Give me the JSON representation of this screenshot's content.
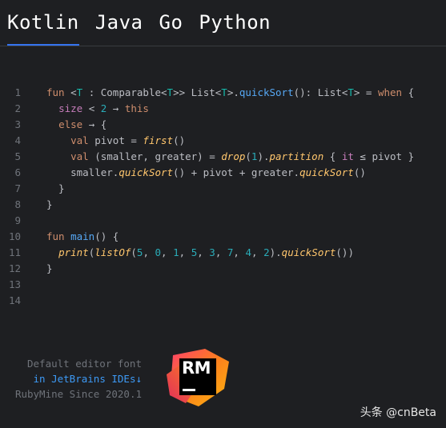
{
  "tabs": [
    "Kotlin",
    "Java",
    "Go",
    "Python"
  ],
  "line_numbers": [
    "1",
    "2",
    "3",
    "4",
    "5",
    "6",
    "7",
    "8",
    "9",
    "10",
    "11",
    "12",
    "13",
    "14"
  ],
  "caption": {
    "line1": "Default editor font",
    "line2": "in JetBrains IDEs↓",
    "line3": "RubyMine Since 2020.1"
  },
  "logo": {
    "text": "RM"
  },
  "watermark": "头条 @cnBeta",
  "colors": {
    "background": "#1e1f22",
    "accent": "#3574f0",
    "keyword": "#cf8e6d",
    "function": "#56a8f5",
    "type_param": "#16baac",
    "number": "#2aacb8"
  }
}
